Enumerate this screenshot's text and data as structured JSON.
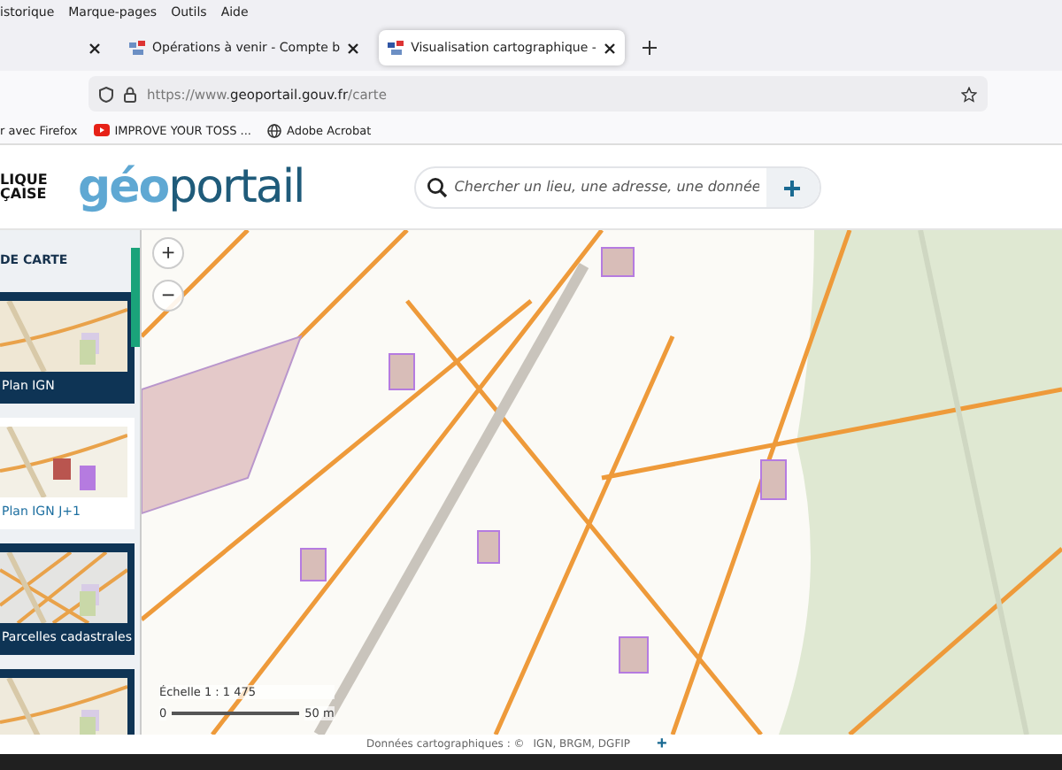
{
  "menu": [
    "istorique",
    "Marque-pages",
    "Outils",
    "Aide"
  ],
  "tabs": [
    {
      "selected": false
    },
    {
      "label": "Opérations à venir - Compte b",
      "selected": false
    },
    {
      "label": "Visualisation cartographique -",
      "selected": true
    }
  ],
  "url": "https://www.**geoportail.gouv.fr**/carte",
  "bookmarks": [
    {
      "kind": "plain",
      "label": "r avec Firefox"
    },
    {
      "kind": "video",
      "label": "IMPROVE YOUR TOSS ..."
    },
    {
      "kind": "globe",
      "label": "Adobe Acrobat"
    }
  ],
  "header": {
    "emblem": [
      "LIQUE",
      "ÇAISE"
    ],
    "brand": [
      "géo",
      "portail"
    ],
    "search": {
      "placeholder": "Chercher un lieu, une adresse, une donnée"
    }
  },
  "sidebar": {
    "title": "DE CARTE",
    "layers": [
      {
        "label": "Plan IGN",
        "selected": true
      },
      {
        "label": "Plan IGN J+1",
        "selected": false
      },
      {
        "label": "Parcelles cadastrales",
        "selected": true
      },
      {
        "selected": true
      }
    ]
  },
  "map": {
    "zoom": [
      "+",
      "−"
    ],
    "scale": "Échelle 1 : 1 475",
    "scale_ticks": [
      "0",
      "50 m"
    ]
  },
  "attribution": {
    "text": "Données cartographiques : ©",
    "sources": "IGN,  BRGM,  DGFIP",
    "more": "+"
  }
}
